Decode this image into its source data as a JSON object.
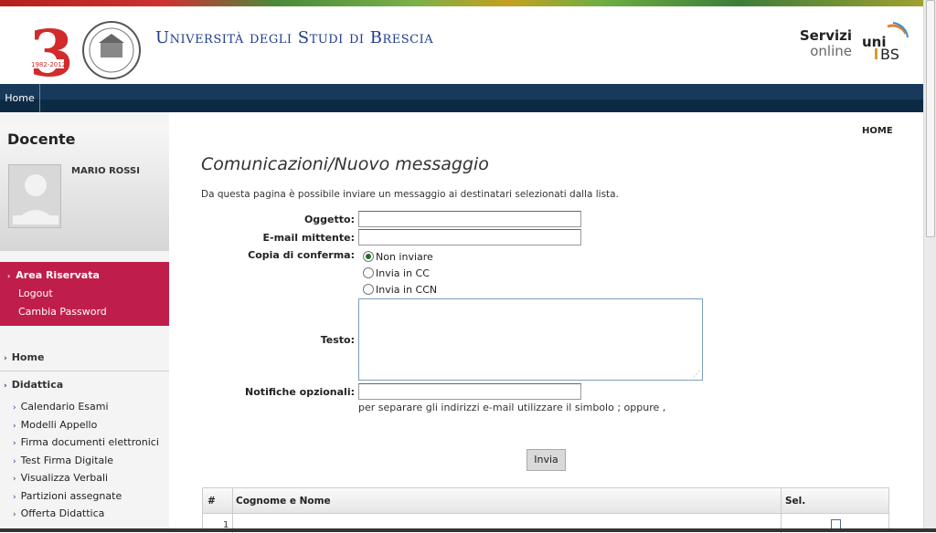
{
  "header": {
    "university_title": "Università degli Studi di Brescia",
    "logo_years": "1982-2012",
    "servizi_line1": "Servizi",
    "servizi_line2": "online",
    "brand_logo_text": "uniBS"
  },
  "nav": {
    "home": "Home"
  },
  "breadcrumb": {
    "home": "HOME"
  },
  "sidebar": {
    "section_title": "Docente",
    "user_name": "MARIO ROSSI",
    "area": {
      "title": "Area Riservata",
      "links": [
        "Logout",
        "Cambia Password"
      ]
    },
    "menu": {
      "home": "Home",
      "didattica": "Didattica",
      "items": [
        "Calendario Esami",
        "Modelli Appello",
        "Firma documenti elettronici",
        "Test Firma Digitale",
        "Visualizza Verbali",
        "Partizioni assegnate",
        "Offerta Didattica"
      ]
    }
  },
  "main": {
    "title": "Comunicazioni/Nuovo messaggio",
    "intro": "Da questa pagina è possibile inviare un messaggio ai destinatari selezionati dalla lista.",
    "form": {
      "oggetto_label": "Oggetto:",
      "oggetto_value": "",
      "email_label": "E-mail mittente:",
      "email_value": "",
      "copia_label": "Copia di conferma:",
      "copia_options": [
        "Non inviare",
        "Invia in CC",
        "Invia in CCN"
      ],
      "copia_selected": "Non inviare",
      "testo_label": "Testo:",
      "testo_value": "",
      "notifiche_label": "Notifiche opzionali:",
      "notifiche_value": "",
      "hint": "per separare gli indirizzi e-mail utilizzare il simbolo ; oppure ,",
      "submit": "Invia"
    },
    "table": {
      "headers": [
        "#",
        "Cognome e Nome",
        "Sel."
      ],
      "rows": [
        {
          "num": "1",
          "name": "",
          "selected": false
        }
      ]
    }
  },
  "colors": {
    "brand_blue": "#1f3d8a",
    "nav_dark": "#173a5a",
    "accent_crimson": "#c01e4a"
  }
}
